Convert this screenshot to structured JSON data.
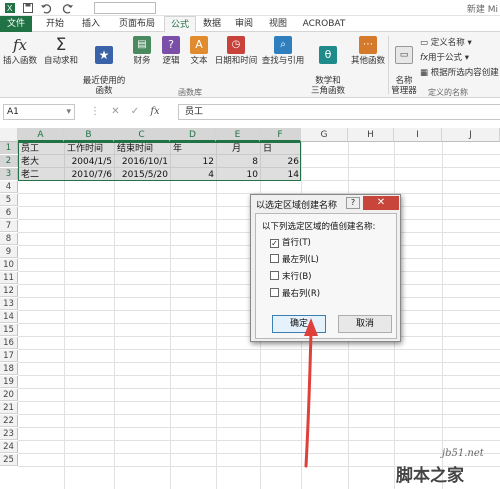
{
  "window": {
    "title_fragment": "新建 Mi"
  },
  "tabs": [
    {
      "label": "文件"
    },
    {
      "label": "开始"
    },
    {
      "label": "插入"
    },
    {
      "label": "页面布局"
    },
    {
      "label": "公式"
    },
    {
      "label": "数据"
    },
    {
      "label": "审阅"
    },
    {
      "label": "视图"
    },
    {
      "label": "ACROBAT"
    }
  ],
  "active_tab": "公式",
  "ribbon": {
    "insert_function": "插入函数",
    "autosum": "自动求和",
    "recent": "最近使用的\n函数",
    "financial": "财务",
    "logical": "逻辑",
    "text": "文本",
    "datetime": "日期和时间",
    "lookup": "查找与引用",
    "math": "数学和\n三角函数",
    "more": "其他函数",
    "library_group": "函数库",
    "name_manager": "名称\n管理器",
    "define_name": "定义名称",
    "use_in_formula": "用于公式",
    "create_from_selection": "根据所选内容创建",
    "names_group": "定义的名称",
    "icons": {
      "insert_function": "fx-icon",
      "autosum": "sigma-icon",
      "recent": "star-icon",
      "financial": "book-icon",
      "logical": "question-icon",
      "text": "text-icon",
      "datetime": "clock-icon",
      "lookup": "magnifier-icon",
      "math": "theta-icon",
      "more": "more-icon"
    }
  },
  "formula_bar": {
    "name_box": "A1",
    "fx": "fx",
    "value": "员工"
  },
  "grid": {
    "columns": [
      "A",
      "B",
      "C",
      "D",
      "E",
      "F",
      "G",
      "H",
      "I",
      "J"
    ],
    "rows": [
      "1",
      "2",
      "3",
      "4",
      "5",
      "6",
      "7",
      "8",
      "9",
      "10",
      "11",
      "12",
      "13",
      "14",
      "15",
      "16",
      "17",
      "18",
      "19",
      "20",
      "21",
      "22",
      "23",
      "24",
      "25"
    ],
    "cells": {
      "A1": "员工",
      "B1": "工作时间",
      "C1": "结束时间",
      "D1": "年",
      "E1": "月",
      "F1": "日",
      "A2": "老大",
      "B2": "2004/1/5",
      "C2": "2016/10/1",
      "D2": "12",
      "E2": "8",
      "F2": "26",
      "A3": "老二",
      "B3": "2010/7/6",
      "C3": "2015/5/20",
      "D3": "4",
      "E3": "10",
      "F3": "14"
    }
  },
  "dialog": {
    "title": "以选定区域创建名称",
    "help": "?",
    "close": "✕",
    "prompt": "以下列选定区域的值创建名称:",
    "options": [
      {
        "label": "首行(T)",
        "checked": true
      },
      {
        "label": "最左列(L)",
        "checked": false
      },
      {
        "label": "末行(B)",
        "checked": false
      },
      {
        "label": "最右列(R)",
        "checked": false
      }
    ],
    "ok": "确定",
    "cancel": "取消"
  },
  "colors": {
    "accent": "#217346",
    "arrow": "#e0403a",
    "close": "#c7453a"
  },
  "watermark": {
    "line1": "jb51.net",
    "line2": "脚本之家"
  }
}
